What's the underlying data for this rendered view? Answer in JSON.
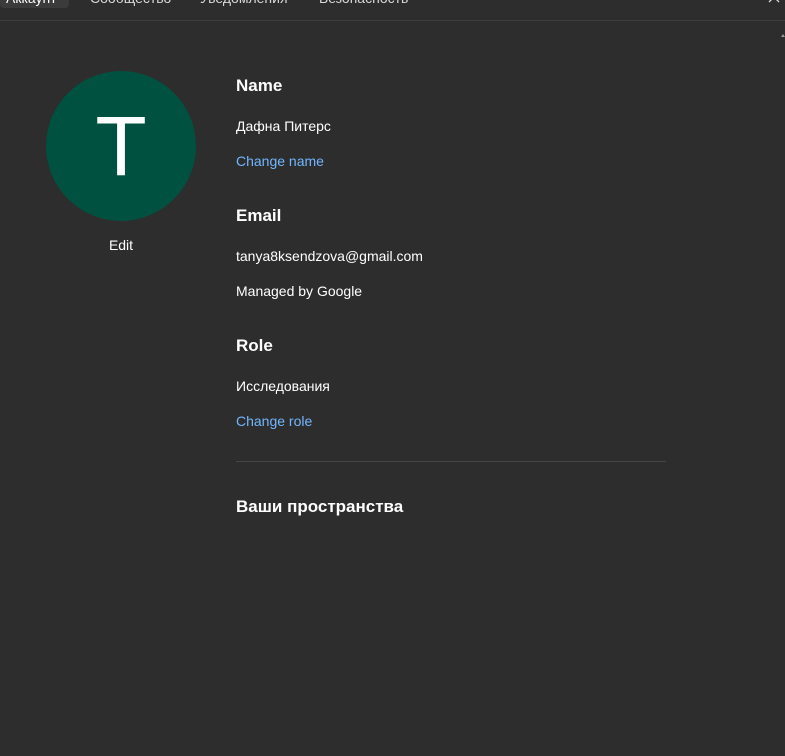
{
  "tabs": [
    {
      "label": "Аккаунт",
      "active": true
    },
    {
      "label": "Сообщество"
    },
    {
      "label": "Уведомления"
    },
    {
      "label": "Безопасность"
    }
  ],
  "profile": {
    "avatar_letter": "T",
    "avatar_color": "#00513f",
    "edit_label": "Edit"
  },
  "name_section": {
    "title": "Name",
    "value": "Дафна Питерс",
    "change_label": "Change name"
  },
  "email_section": {
    "title": "Email",
    "value": "tanya8ksendzova@gmail.com",
    "managed_label": "Managed by Google"
  },
  "role_section": {
    "title": "Role",
    "value": "Исследования",
    "change_label": "Change role"
  },
  "spaces_section": {
    "title": "Ваши пространства"
  },
  "colors": {
    "background": "#2d2d2d",
    "link": "#71b7ff"
  }
}
